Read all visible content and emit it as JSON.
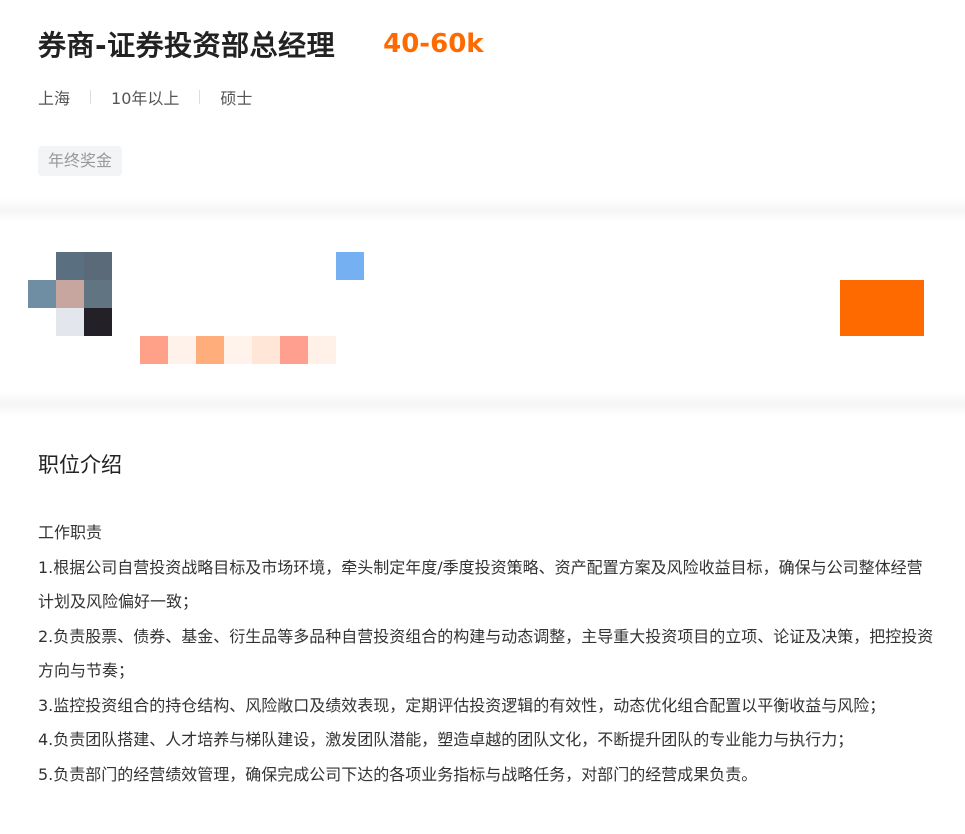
{
  "job": {
    "title": "券商-证券投资部总经理",
    "salary": "40-60k",
    "city": "上海",
    "experience": "10年以上",
    "education": "硕士",
    "tags": [
      "年终奖金"
    ]
  },
  "company": {
    "avatar_colors": [
      "#ffffff",
      "#5a6f80",
      "#5a6a78",
      "#6f8da3",
      "#c8a6a0",
      "#607482",
      "#ffffff",
      "#e4e6ee",
      "#232027"
    ],
    "name_colors": [
      "#ffa089",
      "#fff2ea",
      "#ffad7a",
      "#fff3ec",
      "#ffe6d6",
      "#ff9f90",
      "#fff0e8"
    ],
    "badge_color": "#74b0f2",
    "action_color": "#ff6a00"
  },
  "description": {
    "section_title": "职位介绍",
    "lines": [
      "工作职责",
      "1.根据公司自营投资战略目标及市场环境，牵头制定年度/季度投资策略、资产配置方案及风险收益目标，确保与公司整体经营计划及风险偏好一致；",
      "2.负责股票、债券、基金、衍生品等多品种自营投资组合的构建与动态调整，主导重大投资项目的立项、论证及决策，把控投资方向与节奏；",
      "3.监控投资组合的持仓结构、风险敞口及绩效表现，定期评估投资逻辑的有效性，动态优化组合配置以平衡收益与风险；",
      "4.负责团队搭建、人才培养与梯队建设，激发团队潜能，塑造卓越的团队文化，不断提升团队的专业能力与执行力；",
      "5.负责部门的经营绩效管理，确保完成公司下达的各项业务指标与战略任务，对部门的经营成果负责。"
    ]
  }
}
